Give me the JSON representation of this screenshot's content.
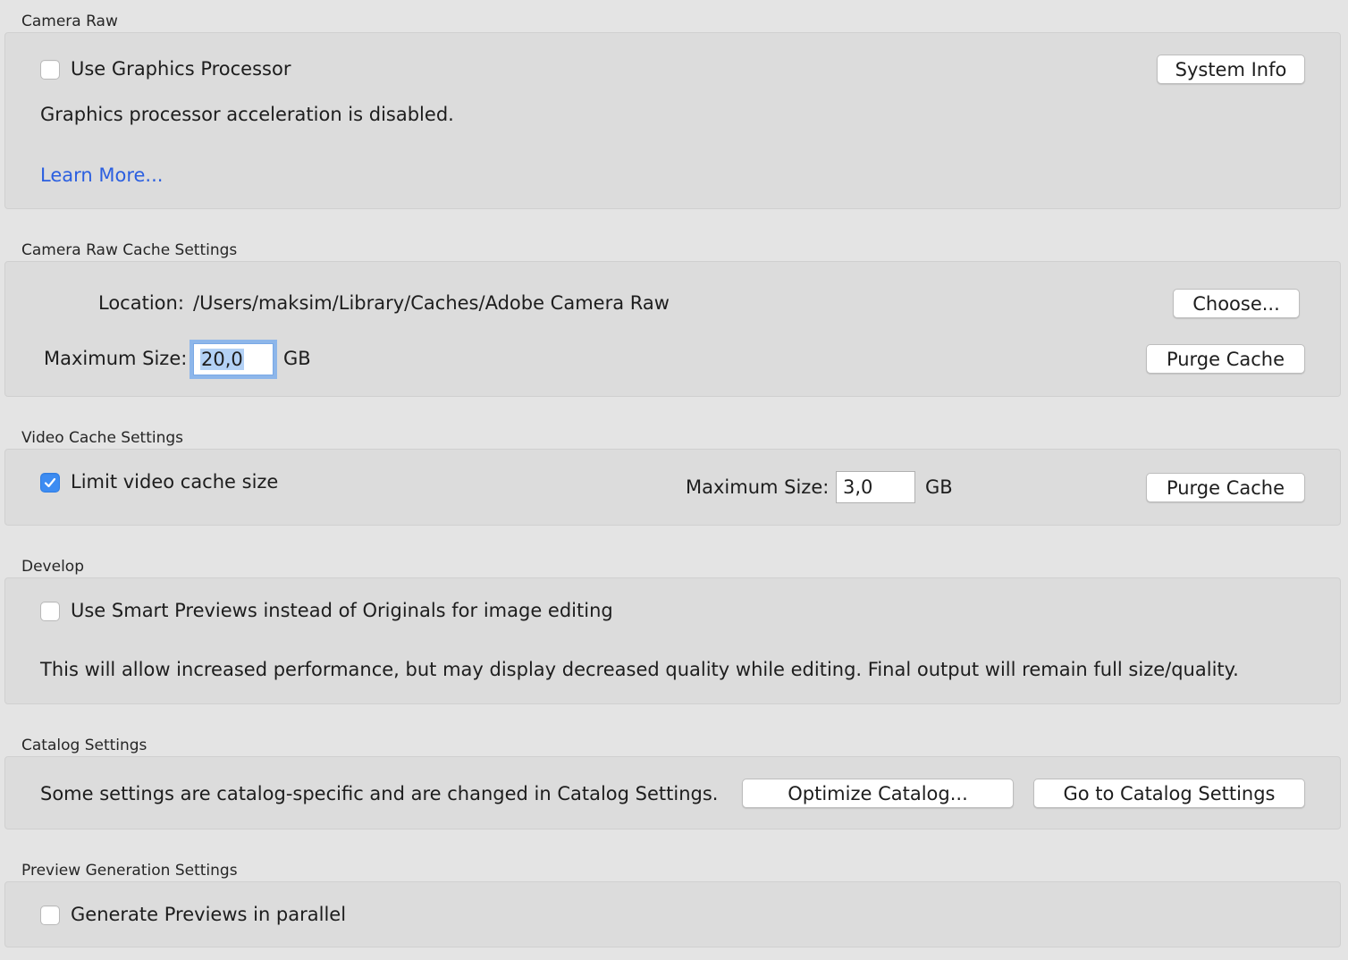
{
  "camera_raw": {
    "title": "Camera Raw",
    "use_gpu_label": "Use Graphics Processor",
    "use_gpu_checked": false,
    "system_info_label": "System Info",
    "status_text": "Graphics processor acceleration is disabled.",
    "learn_more_label": "Learn More..."
  },
  "cache_settings": {
    "title": "Camera Raw Cache Settings",
    "location_label": "Location:",
    "location_path": "/Users/maksim/Library/Caches/Adobe Camera Raw",
    "choose_label": "Choose...",
    "max_size_label": "Maximum Size:",
    "max_size_value": "20,0",
    "unit": "GB",
    "purge_label": "Purge Cache"
  },
  "video_cache": {
    "title": "Video Cache Settings",
    "limit_label": "Limit video cache size",
    "limit_checked": true,
    "max_size_label": "Maximum Size:",
    "max_size_value": "3,0",
    "unit": "GB",
    "purge_label": "Purge Cache"
  },
  "develop": {
    "title": "Develop",
    "smart_previews_label": "Use Smart Previews instead of Originals for image editing",
    "smart_previews_checked": false,
    "description": "This will allow increased performance, but may display decreased quality while editing. Final output will remain full size/quality."
  },
  "catalog": {
    "title": "Catalog Settings",
    "info_text": "Some settings are catalog-specific and are changed in Catalog Settings.",
    "optimize_label": "Optimize Catalog...",
    "goto_label": "Go to Catalog Settings"
  },
  "preview_gen": {
    "title": "Preview Generation Settings",
    "parallel_label": "Generate Previews in parallel",
    "parallel_checked": false
  },
  "colors": {
    "accent": "#3d8cf2",
    "link": "#2b5fe0",
    "focus_ring": "#8db6ea"
  }
}
